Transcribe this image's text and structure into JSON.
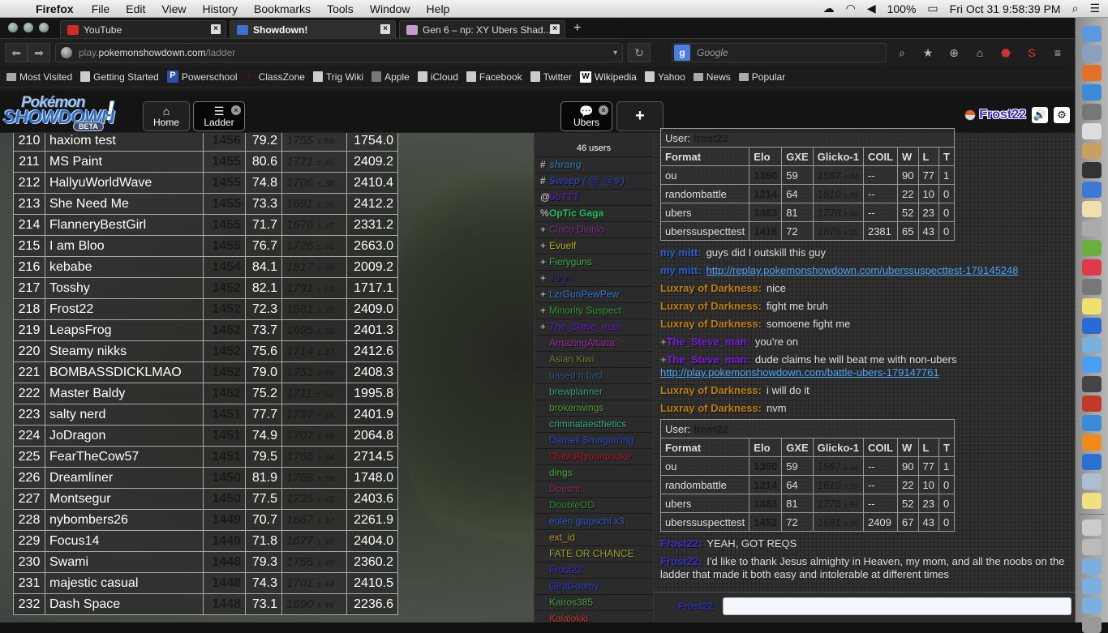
{
  "menubar": {
    "app_name": "Firefox",
    "menus": [
      "File",
      "Edit",
      "View",
      "History",
      "Bookmarks",
      "Tools",
      "Window",
      "Help"
    ],
    "battery": "100%",
    "clock": "Fri Oct 31  9:58:39 PM"
  },
  "browser": {
    "tabs": [
      {
        "title": "YouTube",
        "icon_color": "#d32a26"
      },
      {
        "title": "Showdown!",
        "icon_color": "#3f6fcf",
        "active": true
      },
      {
        "title": "Gen 6 – np: XY Ubers Shad...",
        "icon_color": "#c79ad4"
      }
    ],
    "url_prefix": "play.",
    "url_host": "pokemonshowdown.com",
    "url_path": "/ladder",
    "search_placeholder": "Google",
    "bookmarks": [
      "Most Visited",
      "Getting Started",
      "Powerschool",
      "ClassZone",
      "Trig Wiki",
      "Apple",
      "iCloud",
      "Facebook",
      "Twitter",
      "Wikipedia",
      "Yahoo",
      "News",
      "Popular"
    ]
  },
  "ps_header": {
    "logo_line1": "Pokémon",
    "logo_line2": "SHOWDOWN",
    "logo_beta": "BETA",
    "tabs": {
      "home": "Home",
      "ladder": "Ladder",
      "ubers": "Ubers",
      "new": "+"
    },
    "username": "Frost22",
    "username_color": "#3a2fd6"
  },
  "ladder": {
    "rows": [
      {
        "rank": "210",
        "name": "haxiom test",
        "elo": "1456",
        "gxe": "79.2",
        "glicko": "1755",
        "dev": "± 59",
        "coil": "1754.0"
      },
      {
        "rank": "211",
        "name": "MS Paint",
        "elo": "1455",
        "gxe": "80.6",
        "glicko": "1771",
        "dev": "± 46",
        "coil": "2409.2"
      },
      {
        "rank": "212",
        "name": "HallyuWorldWave",
        "elo": "1455",
        "gxe": "74.8",
        "glicko": "1706",
        "dev": "± 38",
        "coil": "2410.4"
      },
      {
        "rank": "213",
        "name": "She Need Me",
        "elo": "1455",
        "gxe": "73.3",
        "glicko": "1691",
        "dev": "± 36",
        "coil": "2412.2"
      },
      {
        "rank": "214",
        "name": "FlanneryBestGirl",
        "elo": "1455",
        "gxe": "71.7",
        "glicko": "1676",
        "dev": "± 40",
        "coil": "2331.2"
      },
      {
        "rank": "215",
        "name": "I am Bloo",
        "elo": "1455",
        "gxe": "76.7",
        "glicko": "1726",
        "dev": "± 40",
        "coil": "2663.0"
      },
      {
        "rank": "216",
        "name": "kebabe",
        "elo": "1454",
        "gxe": "84.1",
        "glicko": "1817",
        "dev": "± 60",
        "coil": "2009.2"
      },
      {
        "rank": "217",
        "name": "Tosshy",
        "elo": "1452",
        "gxe": "82.1",
        "glicko": "1791",
        "dev": "± 63",
        "coil": "1717.1"
      },
      {
        "rank": "218",
        "name": "Frost22",
        "elo": "1452",
        "gxe": "72.3",
        "glicko": "1681",
        "dev": "± 35",
        "coil": "2409.0"
      },
      {
        "rank": "219",
        "name": "LeapsFrog",
        "elo": "1452",
        "gxe": "73.7",
        "glicko": "1695",
        "dev": "± 38",
        "coil": "2401.3"
      },
      {
        "rank": "220",
        "name": "Steamy nikks",
        "elo": "1452",
        "gxe": "75.6",
        "glicko": "1714",
        "dev": "± 37",
        "coil": "2412.6"
      },
      {
        "rank": "221",
        "name": "BOMBASSDICKLMAO",
        "elo": "1452",
        "gxe": "79.0",
        "glicko": "1751",
        "dev": "± 49",
        "coil": "2408.3"
      },
      {
        "rank": "222",
        "name": "Master Baldy",
        "elo": "1452",
        "gxe": "75.2",
        "glicko": "1711",
        "dev": "± 52",
        "coil": "1995.8"
      },
      {
        "rank": "223",
        "name": "salty nerd",
        "elo": "1451",
        "gxe": "77.7",
        "glicko": "1737",
        "dev": "± 45",
        "coil": "2401.9"
      },
      {
        "rank": "224",
        "name": "JoDragon",
        "elo": "1451",
        "gxe": "74.9",
        "glicko": "1707",
        "dev": "± 48",
        "coil": "2064.8"
      },
      {
        "rank": "225",
        "name": "FearTheCow57",
        "elo": "1451",
        "gxe": "79.5",
        "glicko": "1756",
        "dev": "± 34",
        "coil": "2714.5"
      },
      {
        "rank": "226",
        "name": "Dreamliner",
        "elo": "1450",
        "gxe": "81.9",
        "glicko": "1788",
        "dev": "± 59",
        "coil": "1748.0"
      },
      {
        "rank": "227",
        "name": "Montsegur",
        "elo": "1450",
        "gxe": "77.5",
        "glicko": "1735",
        "dev": "± 45",
        "coil": "2403.6"
      },
      {
        "rank": "228",
        "name": "nybombers26",
        "elo": "1449",
        "gxe": "70.7",
        "glicko": "1667",
        "dev": "± 37",
        "coil": "2261.9"
      },
      {
        "rank": "229",
        "name": "Focus14",
        "elo": "1449",
        "gxe": "71.8",
        "glicko": "1677",
        "dev": "± 40",
        "coil": "2404.0"
      },
      {
        "rank": "230",
        "name": "Swami",
        "elo": "1448",
        "gxe": "79.3",
        "glicko": "1755",
        "dev": "± 49",
        "coil": "2360.2"
      },
      {
        "rank": "231",
        "name": "majestic casual",
        "elo": "1448",
        "gxe": "74.3",
        "glicko": "1701",
        "dev": "± 44",
        "coil": "2410.5"
      },
      {
        "rank": "232",
        "name": "Dash Space",
        "elo": "1448",
        "gxe": "73.1",
        "glicko": "1690",
        "dev": "± 46",
        "coil": "2236.6"
      }
    ]
  },
  "userlist": {
    "count": "46 users",
    "users": [
      {
        "group": "#",
        "name": "shrang",
        "color": "#2f6a93",
        "style": "bi"
      },
      {
        "group": "#",
        "name": "Sweep ( @_@✲)",
        "color": "#2c3fa6",
        "style": "bi"
      },
      {
        "group": "@",
        "name": "boTTT",
        "color": "#5a1a9a",
        "style": "b"
      },
      {
        "group": "%",
        "name": "OpTic Gaga",
        "color": "#22c05a",
        "style": "b"
      },
      {
        "group": "+",
        "name": "Cinco Diablo",
        "color": "#8a2a8a",
        "style": ""
      },
      {
        "group": "+",
        "name": "Evuelf",
        "color": "#b8b20e",
        "style": ""
      },
      {
        "group": "+",
        "name": "Fieryguns",
        "color": "#38b038",
        "style": ""
      },
      {
        "group": "+",
        "name": "Joryn",
        "color": "#2a2a7a",
        "style": ""
      },
      {
        "group": "+",
        "name": "LzrGunPewPew",
        "color": "#2a7ad0",
        "style": ""
      },
      {
        "group": "+",
        "name": "Minority Suspect",
        "color": "#2c9a2c",
        "style": ""
      },
      {
        "group": "+",
        "name": "The_Steve_man",
        "color": "#6a1ad6",
        "style": ""
      },
      {
        "group": "",
        "name": "AmazingAltaria♡",
        "color": "#a02aa0",
        "style": ""
      },
      {
        "group": "",
        "name": "Asian Kiwi",
        "color": "#7a7a2a",
        "style": ""
      },
      {
        "group": "",
        "name": "based n bad",
        "color": "#2a5a7a",
        "style": ""
      },
      {
        "group": "",
        "name": "brewplanner",
        "color": "#2aa07a",
        "style": ""
      },
      {
        "group": "",
        "name": "brokenwings",
        "color": "#4a9a2a",
        "style": ""
      },
      {
        "group": "",
        "name": "criminalaesthetics",
        "color": "#2ab07a",
        "style": ""
      },
      {
        "group": "",
        "name": "Darnell Smogon'ing",
        "color": "#2a4ad0",
        "style": ""
      },
      {
        "group": "",
        "name": "DiabloRyuunosuke",
        "color": "#b01a2a",
        "style": ""
      },
      {
        "group": "",
        "name": "dings",
        "color": "#3ab03a",
        "style": ""
      },
      {
        "group": "",
        "name": "Doesnt",
        "color": "#8a2a6a",
        "style": ""
      },
      {
        "group": "",
        "name": "DoubleOD",
        "color": "#2a8a2a",
        "style": ""
      },
      {
        "group": "",
        "name": "eulen glupschi x3",
        "color": "#2a5ad0",
        "style": ""
      },
      {
        "group": "",
        "name": "ext_id",
        "color": "#b8901a",
        "style": ""
      },
      {
        "group": "",
        "name": "FATE OR CHANCE",
        "color": "#a0a02a",
        "style": ""
      },
      {
        "group": "",
        "name": "Frost22",
        "color": "#3a2fc6",
        "style": ""
      },
      {
        "group": "",
        "name": "GiraGoomy",
        "color": "#2a3ad6",
        "style": ""
      },
      {
        "group": "",
        "name": "Kairos385",
        "color": "#4aa03a",
        "style": ""
      },
      {
        "group": "",
        "name": "Kalalokki",
        "color": "#c03a2a",
        "style": ""
      }
    ]
  },
  "chat": {
    "rank_headers": [
      "Format",
      "Elo",
      "GXE",
      "Glicko-1",
      "COIL",
      "W",
      "L",
      "T"
    ],
    "box1": {
      "user_label": "User:",
      "user": "frost22",
      "rows": [
        {
          "format": "ou",
          "elo": "1350",
          "gxe": "59",
          "glicko": "1567",
          "dev": "± 44",
          "coil": "--",
          "w": "90",
          "l": "77",
          "t": "1"
        },
        {
          "format": "randombattle",
          "elo": "1214",
          "gxe": "64",
          "glicko": "1610",
          "dev": "± 99",
          "coil": "--",
          "w": "22",
          "l": "10",
          "t": "0"
        },
        {
          "format": "ubers",
          "elo": "1483",
          "gxe": "81",
          "glicko": "1778",
          "dev": "± 56",
          "coil": "--",
          "w": "52",
          "l": "23",
          "t": "0"
        },
        {
          "format": "uberssuspecttest",
          "elo": "1418",
          "gxe": "72",
          "glicko": "1676",
          "dev": "± 35",
          "coil": "2381",
          "w": "65",
          "l": "43",
          "t": "0"
        }
      ]
    },
    "messages": [
      {
        "who": "my mitt:",
        "color": "#2a5ed6",
        "text": "guys did I outskill this guy"
      },
      {
        "who": "my mitt:",
        "color": "#2a5ed6",
        "link": "http://replay.pokemonshowdown.com/uberssuspecttest-179145248"
      },
      {
        "who": "Luxray of Darkness:",
        "color": "#c07f0a",
        "text": "nice"
      },
      {
        "who": "Luxray of Darkness:",
        "color": "#c07f0a",
        "text": "fight me bruh"
      },
      {
        "who": "Luxray of Darkness:",
        "color": "#c07f0a",
        "text": "somoene fight me"
      },
      {
        "who": "The_Steve_man:",
        "group": "+",
        "color": "#7a1ae0",
        "text": "you're on"
      },
      {
        "who": "The_Steve_man:",
        "group": "+",
        "color": "#7a1ae0",
        "text": "dude claims he will beat me with non-ubers",
        "link": "http://play.pokemonshowdown.com/battle-ubers-179147761"
      },
      {
        "who": "Luxray of Darkness:",
        "color": "#c07f0a",
        "text": "i will do it"
      },
      {
        "who": "Luxray of Darkness:",
        "color": "#c07f0a",
        "text": "nvm"
      }
    ],
    "box2": {
      "user_label": "User:",
      "user": "frost22",
      "rows": [
        {
          "format": "ou",
          "elo": "1350",
          "gxe": "59",
          "glicko": "1567",
          "dev": "± 44",
          "coil": "--",
          "w": "90",
          "l": "77",
          "t": "1"
        },
        {
          "format": "randombattle",
          "elo": "1214",
          "gxe": "64",
          "glicko": "1610",
          "dev": "± 99",
          "coil": "--",
          "w": "22",
          "l": "10",
          "t": "0"
        },
        {
          "format": "ubers",
          "elo": "1483",
          "gxe": "81",
          "glicko": "1778",
          "dev": "± 56",
          "coil": "--",
          "w": "52",
          "l": "23",
          "t": "0"
        },
        {
          "format": "uberssuspecttest",
          "elo": "1452",
          "gxe": "72",
          "glicko": "1681",
          "dev": "± 35",
          "coil": "2409",
          "w": "67",
          "l": "43",
          "t": "0"
        }
      ]
    },
    "messages2": [
      {
        "who": "Frost22:",
        "color": "#3a2fc6",
        "text": "YEAH, GOT REQS"
      },
      {
        "who": "Frost22:",
        "color": "#3a2fc6",
        "text": "I'd like to thank Jesus almighty in Heaven, my mom, and all the noobs on the ladder that made it both easy and intolerable at different times"
      }
    ],
    "input_label": "Frost22:",
    "input_value": ""
  },
  "dock": {
    "icons": [
      "finder",
      "preview",
      "firefox",
      "safari",
      "system-preferences",
      "calendar",
      "contacts",
      "messages-badge",
      "downloads",
      "textedit",
      "audio",
      "numbers",
      "itunes",
      "launchpad",
      "stickies",
      "quicktime",
      "maps",
      "messages",
      "facetime",
      "photo-booth",
      "iphoto",
      "ibooks",
      "app-store",
      "preview2",
      "notes",
      "mail",
      "help",
      "folder",
      "folder2",
      "downloads-stack",
      "trash"
    ],
    "colors": [
      "#5b9ae0",
      "#8aa0c0",
      "#e0702a",
      "#3a8ad6",
      "#777",
      "#ddd",
      "#c8a060",
      "#333",
      "#3a7ad6",
      "#f0e0b0",
      "#aaa",
      "#6ab040",
      "#e03a4a",
      "#777",
      "#f0e070",
      "#2a6ad6",
      "#7ab0e0",
      "#4aa0f0",
      "#444",
      "#c03a2a",
      "#3a8ad6",
      "#f08a1a",
      "#2a70d0",
      "#aac0d0",
      "#f0e080",
      "#ccc",
      "#bbb",
      "#7ab0e0",
      "#7ab0e0",
      "#7ab0e0",
      "#999"
    ]
  }
}
